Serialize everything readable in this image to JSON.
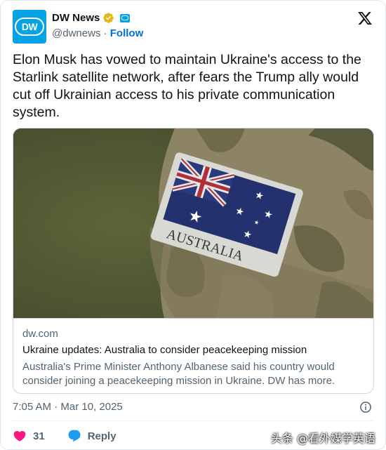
{
  "header": {
    "name": "DW News",
    "handle": "@dwnews",
    "separator": " · ",
    "follow_label": "Follow",
    "avatar_text": "DW",
    "avatar_color": "#05a2e6",
    "verified_color": "#e2b719"
  },
  "tweet": {
    "text": "Elon Musk has vowed to maintain Ukraine's access to the Starlink satellite network, after fears the Trump ally would cut off Ukrainian access to his private communication system."
  },
  "link_card": {
    "patch_text": "AUSTRALIA",
    "domain": "dw.com",
    "title": "Ukraine updates: Australia to consider peacekeeping mission",
    "description": "Australia's Prime Minister Anthony Albanese said his country would consider joining a peacekeeping mission in Ukraine. DW has more."
  },
  "meta": {
    "timestamp": "7:05 AM · Mar 10, 2025"
  },
  "actions": {
    "like_count": "31",
    "reply_label": "Reply",
    "like_color": "#f91880",
    "reply_color": "#1d9bf0"
  },
  "watermark": {
    "text": "头条 @看外媒学英语"
  },
  "icons": [
    "verified-badge-icon",
    "dw-affiliate-icon",
    "x-logo-icon",
    "info-icon",
    "heart-icon",
    "reply-bubble-icon"
  ]
}
